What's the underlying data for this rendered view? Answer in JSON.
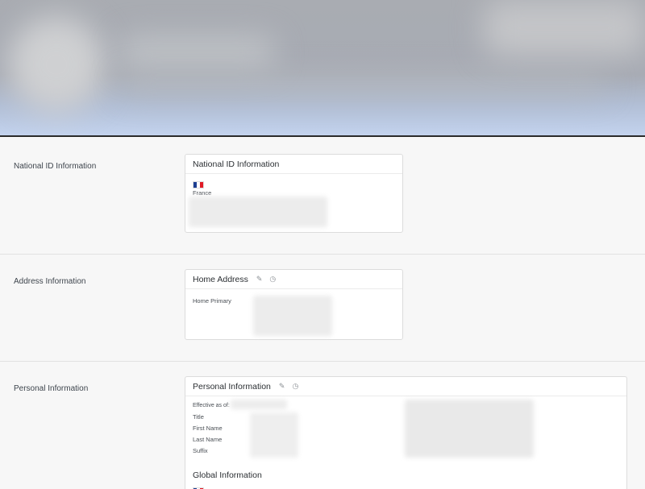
{
  "sections": {
    "national_id": {
      "label": "National ID Information",
      "card_title": "National ID Information",
      "country": "France"
    },
    "address": {
      "label": "Address Information",
      "card_title": "Home Address",
      "field_label": "Home Primary"
    },
    "personal": {
      "label": "Personal Information",
      "card_title": "Personal Information",
      "fields": [
        "Effective as of:",
        "Title",
        "First Name",
        "Last Name",
        "Suffix"
      ],
      "global_heading": "Global Information"
    }
  },
  "icons": {
    "edit": "pencil-icon",
    "history": "clock-history-icon"
  },
  "colors": {
    "flag_blue": "#1d3e91",
    "flag_red": "#e11b26",
    "banner_bottom": "#c3d3ee"
  }
}
